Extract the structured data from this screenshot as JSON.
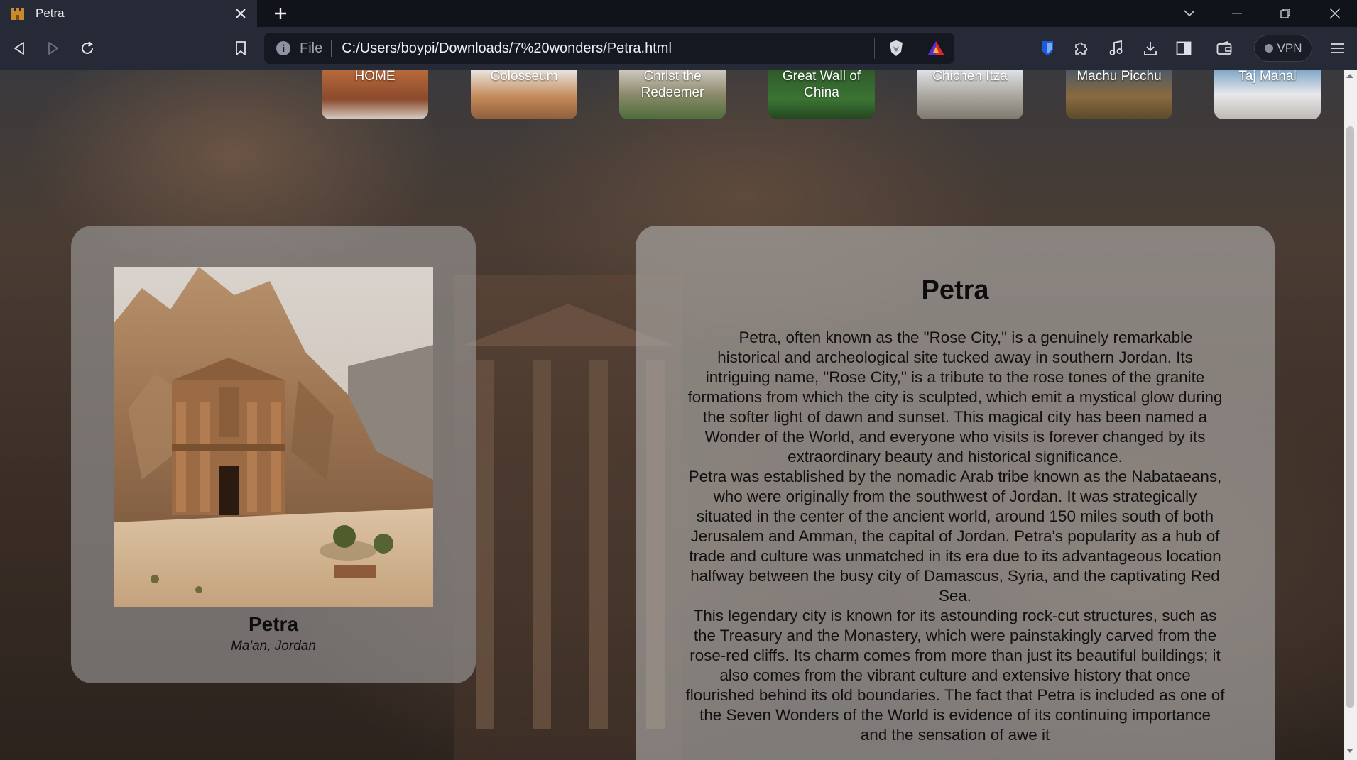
{
  "browser": {
    "tab_title": "Petra",
    "url_scheme_label": "File",
    "url": "C:/Users/boypi/Downloads/7%20wonders/Petra.html",
    "vpn_label": "VPN"
  },
  "nav": {
    "items": [
      {
        "label": "HOME"
      },
      {
        "label": "Colosseum"
      },
      {
        "label": "Christ the Redeemer"
      },
      {
        "label": "Great Wall of China"
      },
      {
        "label": "Chichen Itza"
      },
      {
        "label": "Machu Picchu"
      },
      {
        "label": "Taj Mahal"
      }
    ]
  },
  "feature": {
    "title": "Petra",
    "location": "Ma'an, Jordan"
  },
  "article": {
    "title": "Petra",
    "paragraphs": [
      "Petra, often known as the \"Rose City,\" is a genuinely remarkable historical and archeological site tucked away in southern Jordan. Its intriguing name, \"Rose City,\" is a tribute to the rose tones of the granite formations from which the city is sculpted, which emit a mystical glow during the softer light of dawn and sunset. This magical city has been named a Wonder of the World, and everyone who visits is forever changed by its extraordinary beauty and historical significance.",
      "Petra was established by the nomadic Arab tribe known as the Nabataeans, who were originally from the southwest of Jordan. It was strategically situated in the center of the ancient world, around 150 miles south of both Jerusalem and Amman, the capital of Jordan. Petra's popularity as a hub of trade and culture was unmatched in its era due to its advantageous location halfway between the busy city of Damascus, Syria, and the captivating Red Sea.",
      "This legendary city is known for its astounding rock-cut structures, such as the Treasury and the Monastery, which were painstakingly carved from the rose-red cliffs. Its charm comes from more than just its beautiful buildings; it also comes from the vibrant culture and extensive history that once flourished behind its old boundaries. The fact that Petra is included as one of the Seven Wonders of the World is evidence of its continuing importance and the sensation of awe it"
    ]
  },
  "colors": {
    "tab_bar": "#11131a",
    "toolbar": "#262a36",
    "card_overlay": "#aaaaac",
    "text": "#111111"
  }
}
